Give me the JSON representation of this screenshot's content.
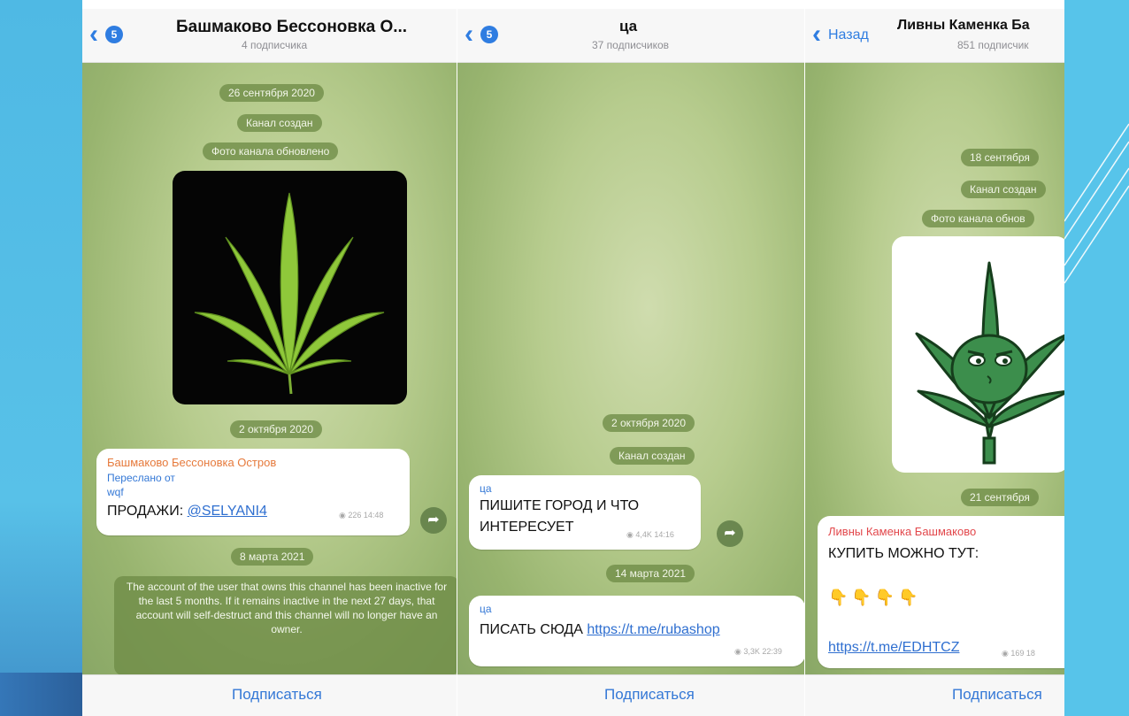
{
  "panel1": {
    "badge": "5",
    "title": "Башмаково Бессоновка О...",
    "subtitle": "4 подписчика",
    "date1": "26 сентября 2020",
    "service1": "Канал создан",
    "service2": "Фото канала обновлено",
    "date2": "2 октября 2020",
    "msg_sender": "Башмаково Бессоновка Остров",
    "forwarded_label": "Переслано от",
    "forwarded_from": "wqf",
    "msg_text": "ПРОДАЖИ: ",
    "msg_link": "@SELYANI4",
    "msg_meta": "226 14:48",
    "date3": "8 марта 2021",
    "notice": "The account of the user that owns this channel has been inactive for the last 5 months. If it remains inactive in the next 27 days, that account will self-destruct and this channel will no longer have an owner.",
    "subscribe": "Подписаться"
  },
  "panel2": {
    "badge": "5",
    "title": "ца",
    "subtitle": "37 подписчиков",
    "date1": "2 октября 2020",
    "service1": "Канал создан",
    "msg1_sender": "ца",
    "msg1_line1": "ПИШИТЕ ГОРОД И ЧТО",
    "msg1_line2": "ИНТЕРЕСУЕТ",
    "msg1_meta": "4,4K 14:16",
    "date2": "14 марта 2021",
    "msg2_sender": "ца",
    "msg2_text": "ПИСАТЬ СЮДА ",
    "msg2_link": "https://t.me/rubashop",
    "msg2_meta": "3,3K 22:39",
    "subscribe": "Подписаться"
  },
  "panel3": {
    "back_label": "Назад",
    "title": "Ливны Каменка Ба",
    "subtitle": "851 подписчик",
    "date1": "18 сентября",
    "service1": "Канал создан",
    "service2": "Фото канала обнов",
    "date2": "21 сентября",
    "msg_sender": "Ливны Каменка Башмаково",
    "msg_text": "КУПИТЬ МОЖНО ТУТ:",
    "msg_emoji": "👇👇👇👇",
    "msg_link": "https://t.me/EDHTCZ",
    "msg_meta": "169 18",
    "subscribe": "Подписаться"
  },
  "colors": {
    "accent": "#2f7de1",
    "slide_blue": "#57c4ea",
    "chat_green": "#b7cc8e",
    "sender_orange": "#e67a3c"
  }
}
